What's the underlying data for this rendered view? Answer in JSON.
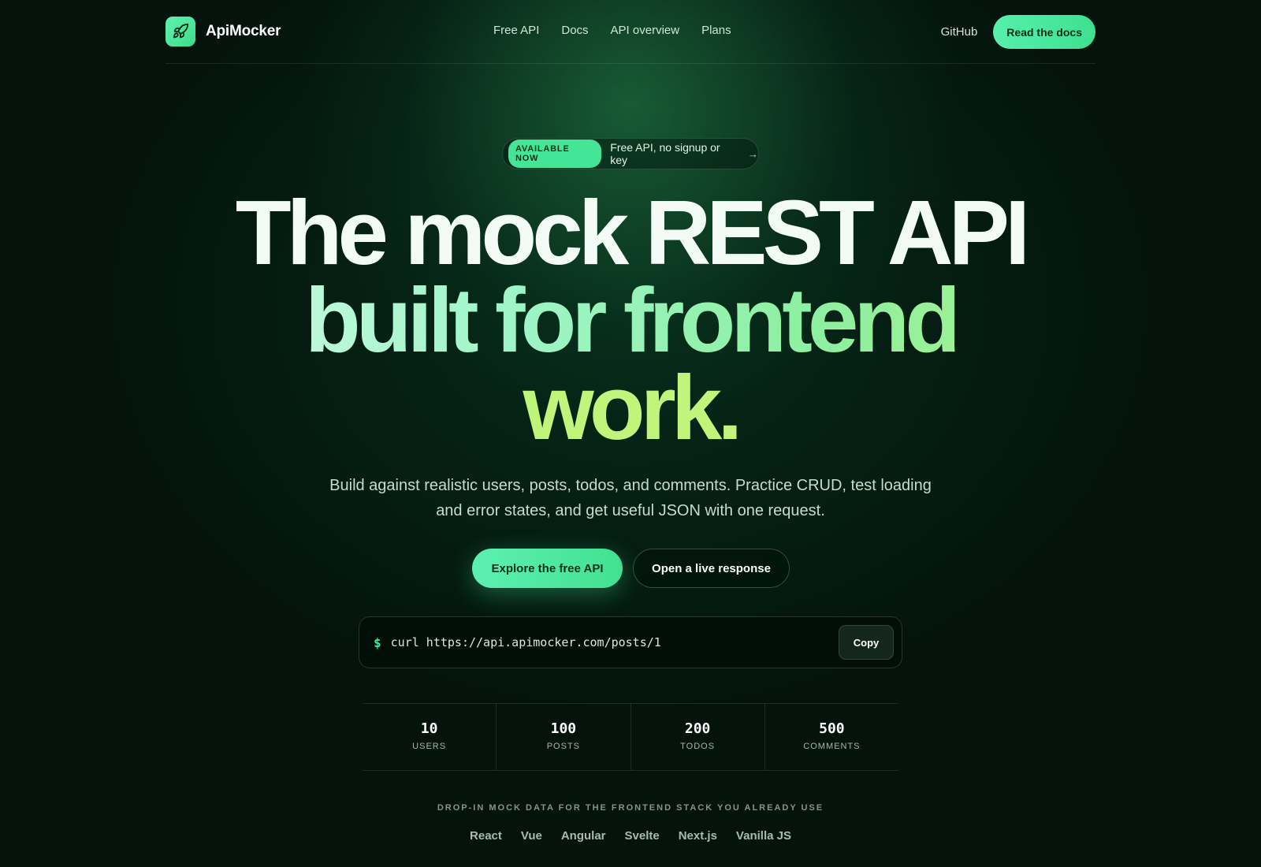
{
  "brand": {
    "name": "ApiMocker",
    "logo_icon": "rocket-icon"
  },
  "nav": {
    "links": [
      "Free API",
      "Docs",
      "API overview",
      "Plans"
    ],
    "github_label": "GitHub",
    "cta_label": "Read the docs"
  },
  "announcement": {
    "badge": "AVAILABLE NOW",
    "text": "Free API, no signup or key",
    "arrow": "→"
  },
  "hero": {
    "line1": "The mock REST API",
    "line2": "built for frontend",
    "line3": "work.",
    "subtitle": "Build against realistic users, posts, todos, and comments. Practice CRUD, test loading and error states, and get useful JSON with one request."
  },
  "cta": {
    "primary_label": "Explore the free API",
    "secondary_label": "Open a live response"
  },
  "code": {
    "prompt": "$",
    "command": "curl https://api.apimocker.com/posts/1",
    "copy_label": "Copy"
  },
  "stats": [
    {
      "value": "10",
      "label": "USERS"
    },
    {
      "value": "100",
      "label": "POSTS"
    },
    {
      "value": "200",
      "label": "TODOS"
    },
    {
      "value": "500",
      "label": "COMMENTS"
    }
  ],
  "stack": {
    "caption": "DROP-IN MOCK DATA FOR THE FRONTEND STACK YOU ALREADY USE",
    "items": [
      "React",
      "Vue",
      "Angular",
      "Svelte",
      "Next.js",
      "Vanilla JS"
    ]
  },
  "colors": {
    "accent": "#45e597",
    "background": "#04140d",
    "lime": "#b9f57f"
  }
}
